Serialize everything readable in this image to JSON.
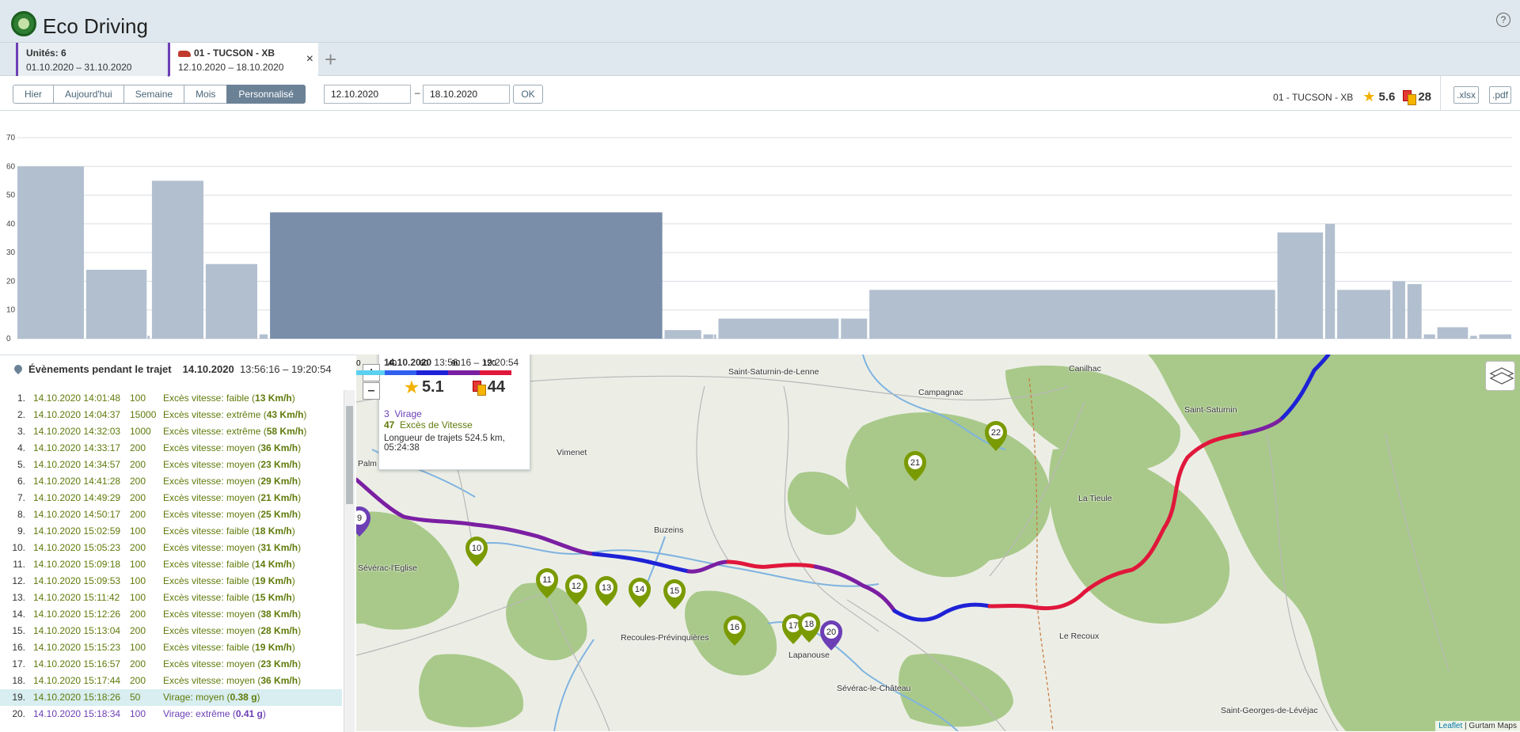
{
  "header": {
    "title": "Eco Driving",
    "help": "?"
  },
  "tabs": [
    {
      "title": "Unités: 6",
      "dates": "01.10.2020  –  31.10.2020"
    },
    {
      "title": "01 - TUCSON - XB",
      "dates": "12.10.2020  –  18.10.2020",
      "close": "×"
    }
  ],
  "add_tab": "+",
  "periods": [
    "Hier",
    "Aujourd'hui",
    "Semaine",
    "Mois",
    "Personnalisé"
  ],
  "selected_period": "Personnalisé",
  "date_from": "12.10.2020",
  "date_sep": "–",
  "date_to": "18.10.2020",
  "ok": "OK",
  "summary": {
    "unit": "01 - TUCSON - XB",
    "rating": "5.6",
    "violations": "28"
  },
  "exports": [
    ".xlsx",
    ".pdf"
  ],
  "chart_data": {
    "type": "bar",
    "ylim": [
      0,
      70
    ],
    "yticks": [
      0,
      10,
      20,
      30,
      40,
      50,
      60,
      70
    ],
    "bars": [
      {
        "x0": 0.0,
        "x1": 0.045,
        "value": 60
      },
      {
        "x0": 0.046,
        "x1": 0.087,
        "value": 24
      },
      {
        "x0": 0.087,
        "x1": 0.089,
        "value": 1
      },
      {
        "x0": 0.09,
        "x1": 0.125,
        "value": 55
      },
      {
        "x0": 0.126,
        "x1": 0.161,
        "value": 26
      },
      {
        "x0": 0.162,
        "x1": 0.168,
        "value": 1.5
      },
      {
        "x0": 0.169,
        "x1": 0.432,
        "value": 44,
        "selected": true
      },
      {
        "x0": 0.433,
        "x1": 0.458,
        "value": 3
      },
      {
        "x0": 0.459,
        "x1": 0.466,
        "value": 1.5
      },
      {
        "x0": 0.466,
        "x1": 0.468,
        "value": 1.5
      },
      {
        "x0": 0.469,
        "x1": 0.55,
        "value": 7
      },
      {
        "x0": 0.551,
        "x1": 0.569,
        "value": 7
      },
      {
        "x0": 0.57,
        "x1": 0.842,
        "value": 17
      },
      {
        "x0": 0.843,
        "x1": 0.874,
        "value": 37
      },
      {
        "x0": 0.875,
        "x1": 0.882,
        "value": 40
      },
      {
        "x0": 0.883,
        "x1": 0.919,
        "value": 17
      },
      {
        "x0": 0.92,
        "x1": 0.929,
        "value": 20
      },
      {
        "x0": 0.93,
        "x1": 0.94,
        "value": 19
      },
      {
        "x0": 0.941,
        "x1": 0.949,
        "value": 1.5
      },
      {
        "x0": 0.95,
        "x1": 0.971,
        "value": 4
      },
      {
        "x0": 0.972,
        "x1": 0.977,
        "value": 1
      },
      {
        "x0": 0.978,
        "x1": 1.0,
        "value": 1.5
      }
    ]
  },
  "events_panel": {
    "title": "Évènements pendant le trajet",
    "date": "14.10.2020",
    "time": "13:56:16 – 19:20:54",
    "rows": [
      {
        "n": "1.",
        "dt": "14.10.2020 14:01:48",
        "pts": "100",
        "desc": "Excès vitesse: faible (",
        "val": "13 Km/h",
        "end": ")"
      },
      {
        "n": "2.",
        "dt": "14.10.2020 14:04:37",
        "pts": "15000",
        "desc": "Excès vitesse: extrême (",
        "val": "43 Km/h",
        "end": ")"
      },
      {
        "n": "3.",
        "dt": "14.10.2020 14:32:03",
        "pts": "1000",
        "desc": "Excès vitesse: extrême (",
        "val": "58 Km/h",
        "end": ")"
      },
      {
        "n": "4.",
        "dt": "14.10.2020 14:33:17",
        "pts": "200",
        "desc": "Excès vitesse: moyen (",
        "val": "36 Km/h",
        "end": ")"
      },
      {
        "n": "5.",
        "dt": "14.10.2020 14:34:57",
        "pts": "200",
        "desc": "Excès vitesse: moyen (",
        "val": "23 Km/h",
        "end": ")"
      },
      {
        "n": "6.",
        "dt": "14.10.2020 14:41:28",
        "pts": "200",
        "desc": "Excès vitesse: moyen (",
        "val": "29 Km/h",
        "end": ")"
      },
      {
        "n": "7.",
        "dt": "14.10.2020 14:49:29",
        "pts": "200",
        "desc": "Excès vitesse: moyen (",
        "val": "21 Km/h",
        "end": ")"
      },
      {
        "n": "8.",
        "dt": "14.10.2020 14:50:17",
        "pts": "200",
        "desc": "Excès vitesse: moyen (",
        "val": "25 Km/h",
        "end": ")"
      },
      {
        "n": "9.",
        "dt": "14.10.2020 15:02:59",
        "pts": "100",
        "desc": "Excès vitesse: faible (",
        "val": "18 Km/h",
        "end": ")"
      },
      {
        "n": "10.",
        "dt": "14.10.2020 15:05:23",
        "pts": "200",
        "desc": "Excès vitesse: moyen (",
        "val": "31 Km/h",
        "end": ")"
      },
      {
        "n": "11.",
        "dt": "14.10.2020 15:09:18",
        "pts": "100",
        "desc": "Excès vitesse: faible (",
        "val": "14 Km/h",
        "end": ")"
      },
      {
        "n": "12.",
        "dt": "14.10.2020 15:09:53",
        "pts": "100",
        "desc": "Excès vitesse: faible (",
        "val": "19 Km/h",
        "end": ")"
      },
      {
        "n": "13.",
        "dt": "14.10.2020 15:11:42",
        "pts": "100",
        "desc": "Excès vitesse: faible (",
        "val": "15 Km/h",
        "end": ")"
      },
      {
        "n": "14.",
        "dt": "14.10.2020 15:12:26",
        "pts": "200",
        "desc": "Excès vitesse: moyen (",
        "val": "38 Km/h",
        "end": ")"
      },
      {
        "n": "15.",
        "dt": "14.10.2020 15:13:04",
        "pts": "200",
        "desc": "Excès vitesse: moyen (",
        "val": "28 Km/h",
        "end": ")"
      },
      {
        "n": "16.",
        "dt": "14.10.2020 15:15:23",
        "pts": "100",
        "desc": "Excès vitesse: faible (",
        "val": "19 Km/h",
        "end": ")"
      },
      {
        "n": "17.",
        "dt": "14.10.2020 15:16:57",
        "pts": "200",
        "desc": "Excès vitesse: moyen (",
        "val": "23 Km/h",
        "end": ")"
      },
      {
        "n": "18.",
        "dt": "14.10.2020 15:17:44",
        "pts": "200",
        "desc": "Excès vitesse: moyen (",
        "val": "36 Km/h",
        "end": ")"
      },
      {
        "n": "19.",
        "dt": "14.10.2020 15:18:26",
        "pts": "50",
        "desc": "Virage: moyen (",
        "val": "0.38 g",
        "end": ")",
        "selected": true,
        "kind": "turn"
      },
      {
        "n": "20.",
        "dt": "14.10.2020 15:18:34",
        "pts": "100",
        "desc": "Virage: extrême (",
        "val": "0.41 g",
        "end": ")",
        "kind": "turn"
      }
    ]
  },
  "popup": {
    "date": "14.10.2020",
    "time": "13:56:16 – 19:20:54",
    "rating": "5.1",
    "violations": "44",
    "ev1_count": "3",
    "ev1_label": "Virage",
    "ev2_count": "47",
    "ev2_label": "Excès de Vitesse",
    "length": "Longueur de trajets 524.5 km, 05:24:38"
  },
  "map": {
    "zoom_in": "+",
    "zoom_out": "–",
    "labels": [
      "Saint-Saturnin-de-Lenne",
      "Campagnac",
      "Canilhac",
      "Saint-Saturnin",
      "Vimenet",
      "Palm",
      "La Tieule",
      "Buzeins",
      "Sévérac-l'Eglise",
      "Recoules-Prévinquières",
      "Lapanouse",
      "Sévérac-le-Château",
      "Le Recoux",
      "Saint-Georges-de-Lévéjac"
    ],
    "markers": [
      "9",
      "10",
      "11",
      "12",
      "13",
      "14",
      "15",
      "16",
      "17",
      "18",
      "20",
      "21",
      "22"
    ],
    "legend_ticks": [
      "0",
      "40",
      "60",
      "90",
      "120"
    ],
    "attribution_link": "Leaflet",
    "attribution_text": " | Gurtam Maps"
  },
  "colors": {
    "bar": "#b2bfcf",
    "bar_selected": "#7a8eaa",
    "marker": "#7a9a01",
    "marker_turn": "#6c3fb5",
    "route_fast": "#e0173b",
    "route_mid": "#7b1fa2",
    "route_slow": "#1e22d6"
  }
}
